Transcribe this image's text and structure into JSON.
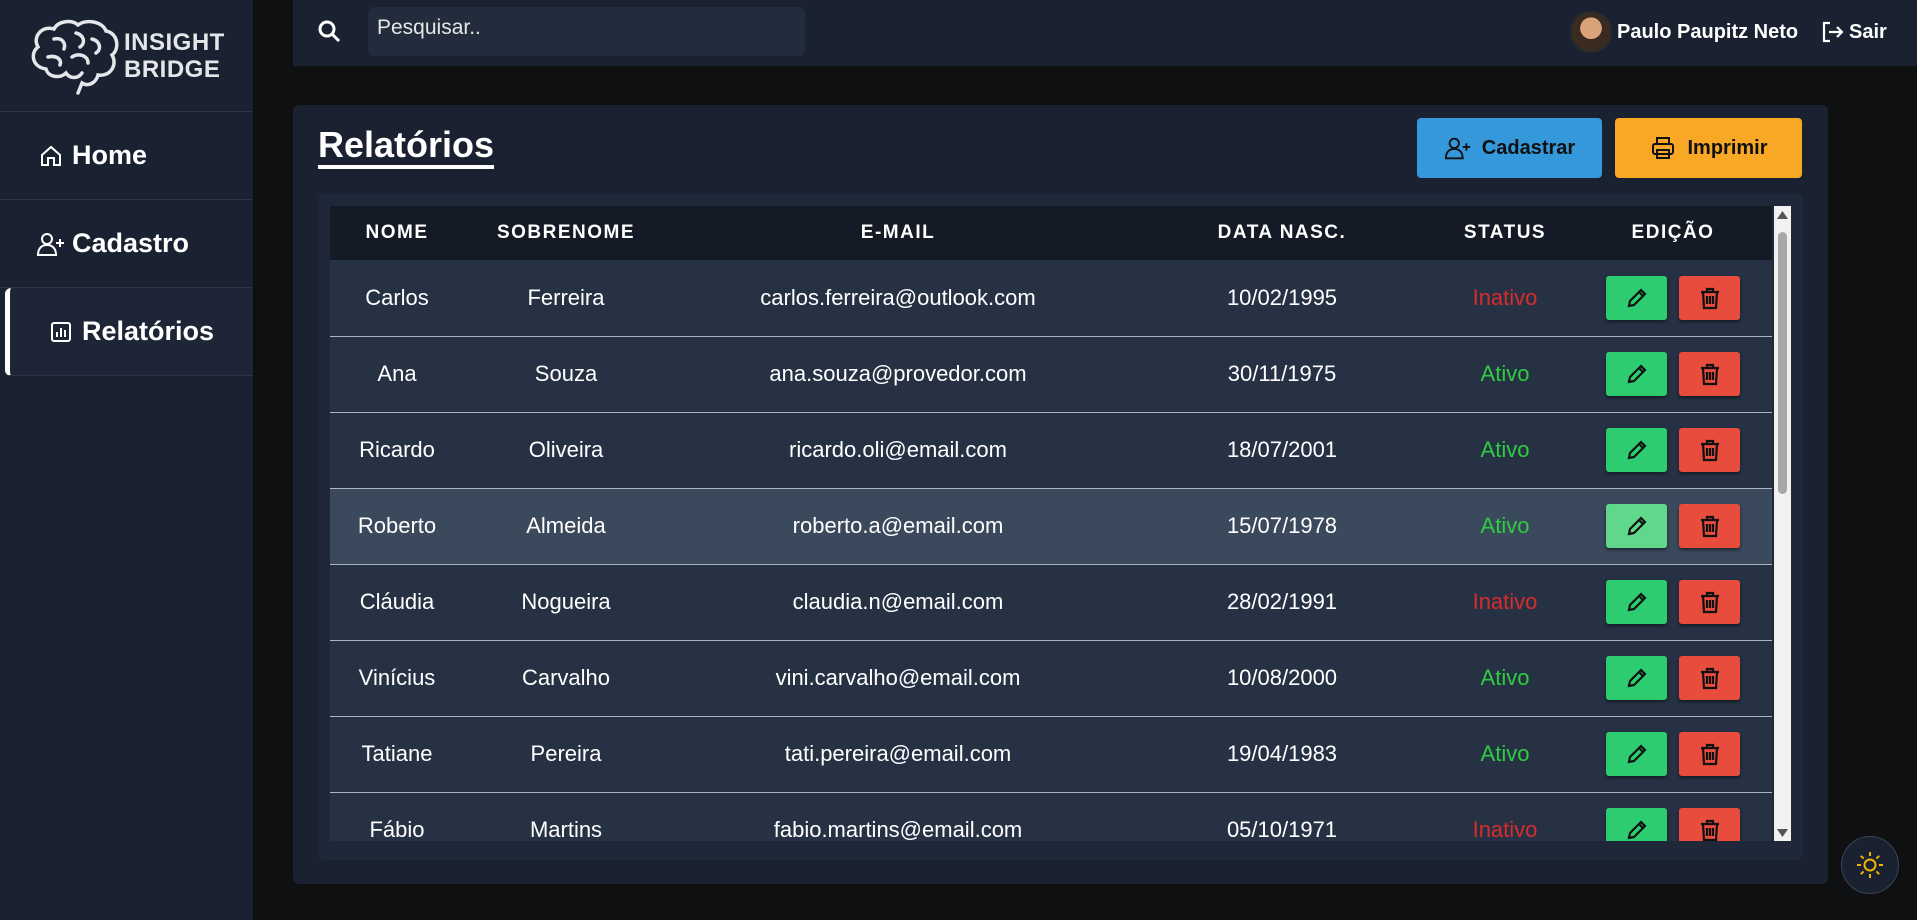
{
  "brand": {
    "line1": "INSIGHT",
    "line2": "BRIDGE",
    "logo_icon": "brain-icon"
  },
  "sidebar": {
    "items": [
      {
        "label": "Home",
        "icon": "home-icon"
      },
      {
        "label": "Cadastro",
        "icon": "user-plus-icon"
      },
      {
        "label": "Relatórios",
        "icon": "chart-icon",
        "active": true
      }
    ]
  },
  "topbar": {
    "search_placeholder": "Pesquisar..",
    "search_value": "",
    "user_name": "Paulo Paupitz Neto",
    "logout_label": "Sair"
  },
  "main": {
    "title": "Relatórios",
    "register_label": "Cadastrar",
    "print_label": "Imprimir"
  },
  "table": {
    "headers": [
      "NOME",
      "SOBRENOME",
      "E-MAIL",
      "DATA NASC.",
      "STATUS",
      "EDIÇÃO"
    ],
    "rows": [
      {
        "nome": "Carlos",
        "sobrenome": "Ferreira",
        "email": "carlos.ferreira@outlook.com",
        "data": "10/02/1995",
        "status": "Inativo"
      },
      {
        "nome": "Ana",
        "sobrenome": "Souza",
        "email": "ana.souza@provedor.com",
        "data": "30/11/1975",
        "status": "Ativo"
      },
      {
        "nome": "Ricardo",
        "sobrenome": "Oliveira",
        "email": "ricardo.oli@email.com",
        "data": "18/07/2001",
        "status": "Ativo"
      },
      {
        "nome": "Roberto",
        "sobrenome": "Almeida",
        "email": "roberto.a@email.com",
        "data": "15/07/1978",
        "status": "Ativo"
      },
      {
        "nome": "Cláudia",
        "sobrenome": "Nogueira",
        "email": "claudia.n@email.com",
        "data": "28/02/1991",
        "status": "Inativo"
      },
      {
        "nome": "Vinícius",
        "sobrenome": "Carvalho",
        "email": "vini.carvalho@email.com",
        "data": "10/08/2000",
        "status": "Ativo"
      },
      {
        "nome": "Tatiane",
        "sobrenome": "Pereira",
        "email": "tati.pereira@email.com",
        "data": "19/04/1983",
        "status": "Ativo"
      },
      {
        "nome": "Fábio",
        "sobrenome": "Martins",
        "email": "fabio.martins@email.com",
        "data": "05/10/1971",
        "status": "Inativo"
      }
    ]
  },
  "colors": {
    "ativo": "#2ecc40",
    "inativo": "#d62c2c",
    "edit_button": "#2ecc71",
    "delete_button": "#e74c3c",
    "register_button": "#3498db",
    "print_button": "#f9a825"
  }
}
